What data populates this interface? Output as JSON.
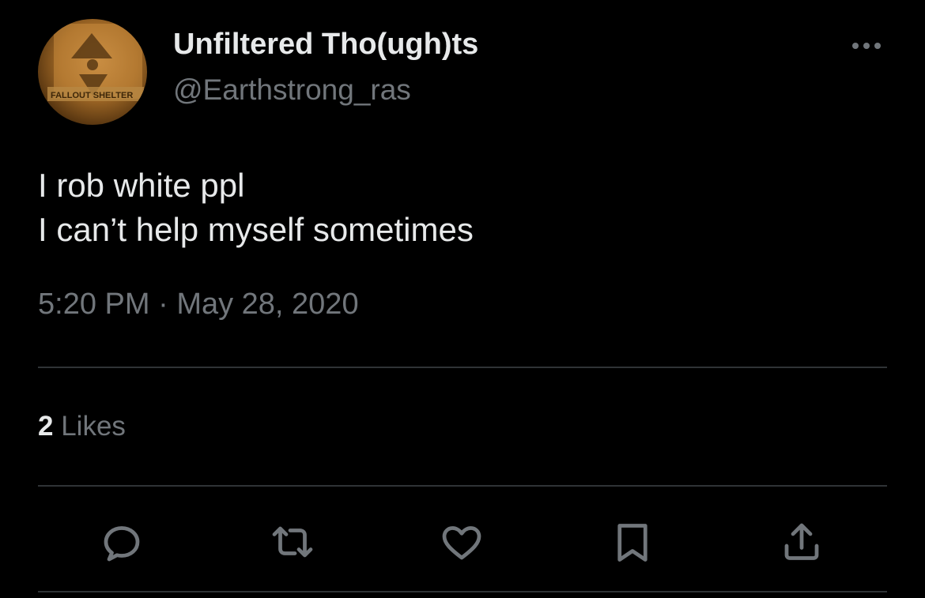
{
  "author": {
    "name": "Unfiltered Tho(ugh)ts",
    "handle": "@Earthstrong_ras",
    "avatar_text": "FALLOUT SHELTER"
  },
  "tweet": {
    "lines": [
      "I rob white ppl",
      "I can’t help myself sometimes"
    ],
    "time": "5:20 PM",
    "separator": "·",
    "date": "May 28, 2020"
  },
  "stats": {
    "likes_count": "2",
    "likes_label": "Likes"
  },
  "actions": [
    {
      "name": "reply",
      "icon": "reply-icon"
    },
    {
      "name": "retweet",
      "icon": "retweet-icon"
    },
    {
      "name": "like",
      "icon": "heart-icon"
    },
    {
      "name": "bookmark",
      "icon": "bookmark-icon"
    },
    {
      "name": "share",
      "icon": "share-icon"
    }
  ],
  "colors": {
    "background": "#000000",
    "primary_text": "#e7e9ea",
    "secondary_text": "#71767b",
    "divider": "#2f3336"
  }
}
